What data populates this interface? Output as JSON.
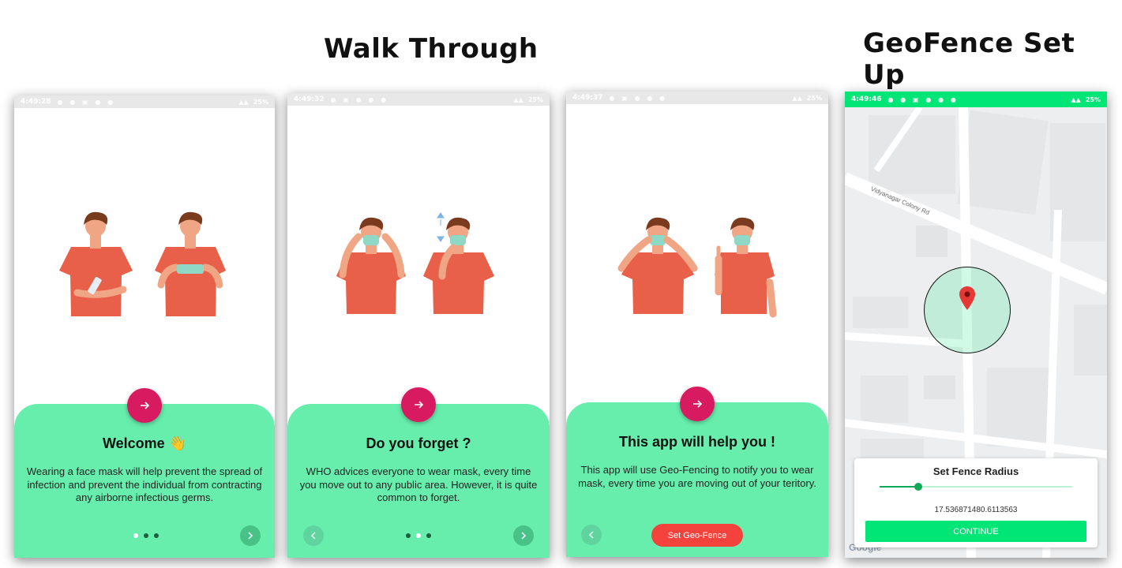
{
  "headings": {
    "walkthrough": "Walk Through",
    "geofence": "GeoFence Set Up"
  },
  "screens": [
    {
      "time": "4:49:28",
      "battery": "25%",
      "title": "Welcome 👋",
      "text": "Wearing a face mask will help prevent the spread of infection and prevent the individual from contracting any airborne infectious germs.",
      "dots": 3,
      "active_dot": 0
    },
    {
      "time": "4:49:32",
      "battery": "25%",
      "title": "Do you forget ?",
      "text": "WHO advices everyone to wear mask, every time you move out to any public area. However, it is quite common to forget.",
      "dots": 3,
      "active_dot": 1
    },
    {
      "time": "4:49:37",
      "battery": "25%",
      "title": "This app will help you !",
      "text": "This app will use Geo-Fencing to notify you to wear mask, every time you are moving out of your teritory.",
      "button": "Set Geo-Fence"
    }
  ],
  "geofence": {
    "time": "4:49:46",
    "battery": "25%",
    "street": "Vidyanagar Colony Rd",
    "card_title": "Set Fence Radius",
    "slider_value": 0.2,
    "radius_value": "17.536871480.6113563",
    "continue": "CONTINUE",
    "map_logo": "Google"
  },
  "colors": {
    "panel": "#67eead",
    "fab": "#d81b60",
    "accent": "#00e676",
    "geo_button": "#f4433c",
    "shirt": "#e8604a",
    "mask": "#8ed8c5"
  },
  "icons": {
    "fab": "arrow-right-icon",
    "next": "chevron-right-icon",
    "prev": "chevron-left-icon",
    "pin": "map-pin-icon"
  }
}
